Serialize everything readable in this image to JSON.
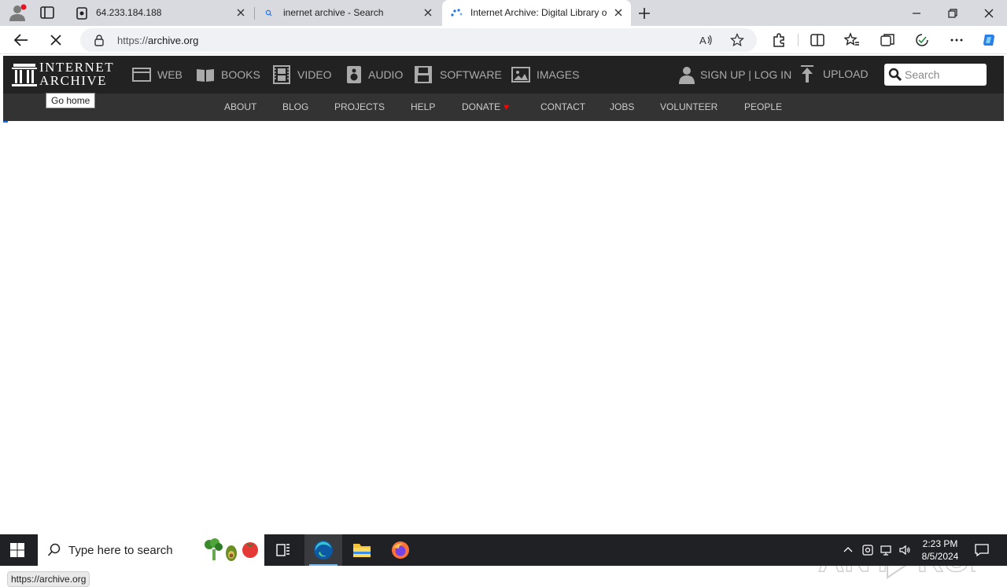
{
  "browser": {
    "tabs": [
      {
        "title": "64.233.184.188",
        "icon": "page-icon"
      },
      {
        "title": "inernet archive - Search",
        "icon": "search-icon"
      },
      {
        "title": "Internet Archive: Digital Library o",
        "icon": "loading-spinner-icon",
        "active": true
      }
    ],
    "url_prefix": "https://",
    "url_host": "archive.org",
    "status_url": "https://archive.org"
  },
  "site": {
    "logo_line1": "INTERNET",
    "logo_line2": "ARCHIVE",
    "tooltip": "Go home",
    "media_nav": [
      {
        "label": "WEB",
        "icon": "web-icon"
      },
      {
        "label": "BOOKS",
        "icon": "book-icon"
      },
      {
        "label": "VIDEO",
        "icon": "film-icon"
      },
      {
        "label": "AUDIO",
        "icon": "speaker-icon"
      },
      {
        "label": "SOFTWARE",
        "icon": "floppy-icon"
      },
      {
        "label": "IMAGES",
        "icon": "image-icon"
      }
    ],
    "signup_label": "SIGN UP | LOG IN",
    "upload_label": "UPLOAD",
    "search_placeholder": "Search",
    "sub_nav": [
      "ABOUT",
      "BLOG",
      "PROJECTS",
      "HELP",
      "DONATE",
      "CONTACT",
      "JOBS",
      "VOLUNTEER",
      "PEOPLE"
    ],
    "heart": "♥"
  },
  "watermark": "ANY RUN",
  "taskbar": {
    "search_placeholder": "Type here to search",
    "time": "2:23 PM",
    "date": "8/5/2024"
  },
  "colors": {
    "ia_header": "#222222",
    "ia_subnav": "#333333",
    "donate_heart": "#ff0000",
    "taskbar": "#202124"
  }
}
